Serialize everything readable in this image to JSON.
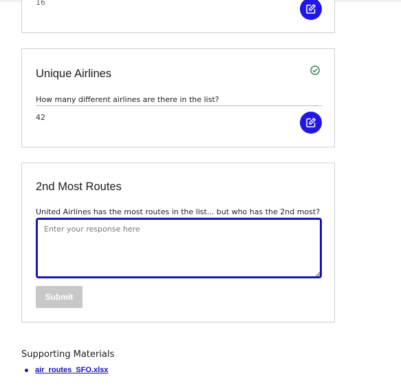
{
  "previous_card": {
    "answer_fragment": "16"
  },
  "unique_airlines": {
    "title": "Unique Airlines",
    "question": "How many different airlines are there in the list?",
    "answer": "42"
  },
  "second_most_routes": {
    "title": "2nd Most Routes",
    "question": "United Airlines has the most routes in the list... but who has the 2nd most?",
    "placeholder": "Enter your response here",
    "submit_label": "Submit"
  },
  "supporting_materials": {
    "title": "Supporting Materials",
    "files": [
      {
        "name": "air_routes_SFO.xlsx"
      }
    ]
  },
  "colors": {
    "accent": "#2016e6",
    "input_focus_border": "#1b14b0",
    "check_green": "#2e7d4f",
    "submit_disabled": "#c8c8c8",
    "link": "#1a0fb8"
  },
  "icons": [
    "edit-icon",
    "check-circle-icon",
    "resize-grip-icon"
  ]
}
